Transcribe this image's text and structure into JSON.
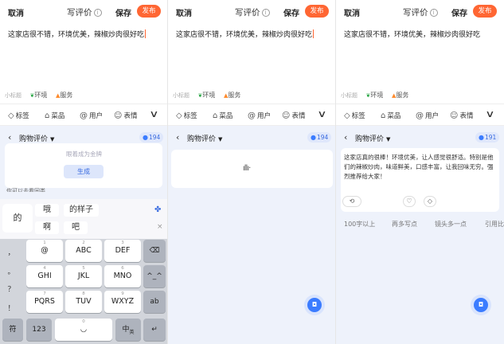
{
  "header": {
    "cancel_label": "取消",
    "title": "写评价",
    "info_icon_glyph": "i",
    "save_label": "保存",
    "publish_label": "发布",
    "publish_color": "#ff6633"
  },
  "review_text": "这家店很不错，环境优美，辣椒炒肉很好吃",
  "tags": {
    "small_title": "小标题",
    "items": [
      {
        "label": "环境",
        "icon": "leaf-icon",
        "glyph": "❦"
      },
      {
        "label": "服务",
        "icon": "bell-icon",
        "glyph": "▲"
      }
    ]
  },
  "toolbar": {
    "items": [
      {
        "label": "标签",
        "icon": "tag-icon",
        "glyph": "◇"
      },
      {
        "label": "菜品",
        "icon": "dish-icon",
        "glyph": "⌂"
      },
      {
        "label": "用户",
        "icon": "at-icon",
        "glyph": "@"
      },
      {
        "label": "表情",
        "icon": "emoji-icon",
        "glyph": "☺"
      }
    ],
    "expand_glyph": "∨"
  },
  "ai_panel": {
    "back_glyph": "‹",
    "label": "购物评价",
    "dropdown_glyph": "▼",
    "accent_color": "#3b7cff"
  },
  "panel1": {
    "credits": "194",
    "hint": "眼着成为金牌",
    "generate_label": "生成",
    "cut_text": "你可以去看同类",
    "candidates": {
      "main": "的",
      "row1": [
        "哦",
        "的样子"
      ],
      "row2": [
        "啊",
        "吧"
      ],
      "emoji_glyph": "✤",
      "close_glyph": "×"
    },
    "keyboard": {
      "side_keys": [
        "，",
        "。",
        "？",
        "！"
      ],
      "rows": [
        [
          {
            "num": "1",
            "letters": "@"
          },
          {
            "num": "2",
            "letters": "ABC"
          },
          {
            "num": "3",
            "letters": "DEF"
          }
        ],
        [
          {
            "num": "4",
            "letters": "GHI"
          },
          {
            "num": "5",
            "letters": "JKL"
          },
          {
            "num": "6",
            "letters": "MNO"
          }
        ],
        [
          {
            "num": "7",
            "letters": "PQRS"
          },
          {
            "num": "8",
            "letters": "TUV"
          },
          {
            "num": "9",
            "letters": "WXYZ"
          }
        ]
      ],
      "backspace_glyph": "⌫",
      "face_label": "^_^",
      "ab_label": "ab",
      "symbol_label": "符",
      "num_label": "123",
      "space_num": "0",
      "space_glyph": "◡",
      "lang_label": "中",
      "lang_sub": "英",
      "enter_glyph": "↵"
    }
  },
  "panel2": {
    "credits": "194",
    "wave_glyph": "ıllı·"
  },
  "panel3": {
    "credits": "191",
    "generated_text": "这家店真的很棒！环境优美，让人感觉很舒适。特别是他们的辣椒炒肉，味道鲜美，口感丰富，让我回味无穷。强烈推荐给大家！",
    "actions": [
      {
        "name": "refresh-button",
        "glyph": "⟲"
      },
      {
        "name": "thumbs-up-button",
        "glyph": "♡"
      },
      {
        "name": "thumbs-down-button",
        "glyph": "◇"
      }
    ],
    "chips": [
      "100字以上",
      "再多写点",
      "镜头多一点",
      "引用比"
    ]
  },
  "ai_button_glyph": "◘"
}
